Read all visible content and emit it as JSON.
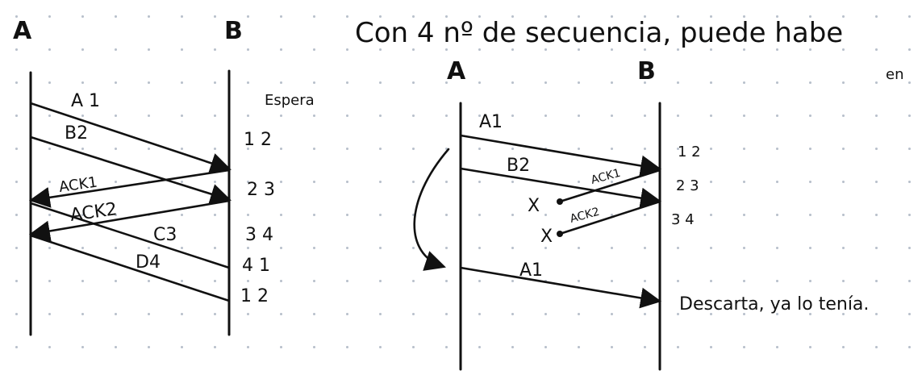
{
  "colors": {
    "ink": "#111111",
    "grid_dot": "#b9c1cc",
    "paper": "#ffffff"
  },
  "heading": "Con 4 nº de secuencia, puede habe",
  "heading_tail": "en",
  "left": {
    "node_a": "A",
    "node_b": "B",
    "window_title": "Espera",
    "messages": {
      "a1": "A 1",
      "b2": "B2",
      "ack1": "ACK1",
      "ack2": "ACK2",
      "c3": "C3",
      "d4": "D4"
    },
    "window_rows": [
      "1  2",
      "2  3",
      "3  4",
      "4  1",
      "1  2"
    ]
  },
  "right": {
    "node_a": "A",
    "node_b": "B",
    "messages": {
      "a1_first": "A1",
      "b2": "B2",
      "ack1": "ACK1",
      "ack2": "ACK2",
      "a1_resent": "A1"
    },
    "loss_marks": [
      "X",
      "X"
    ],
    "window_rows": [
      "1 2",
      "2 3",
      "3 4"
    ],
    "note": "Descarta, ya lo tenía."
  }
}
